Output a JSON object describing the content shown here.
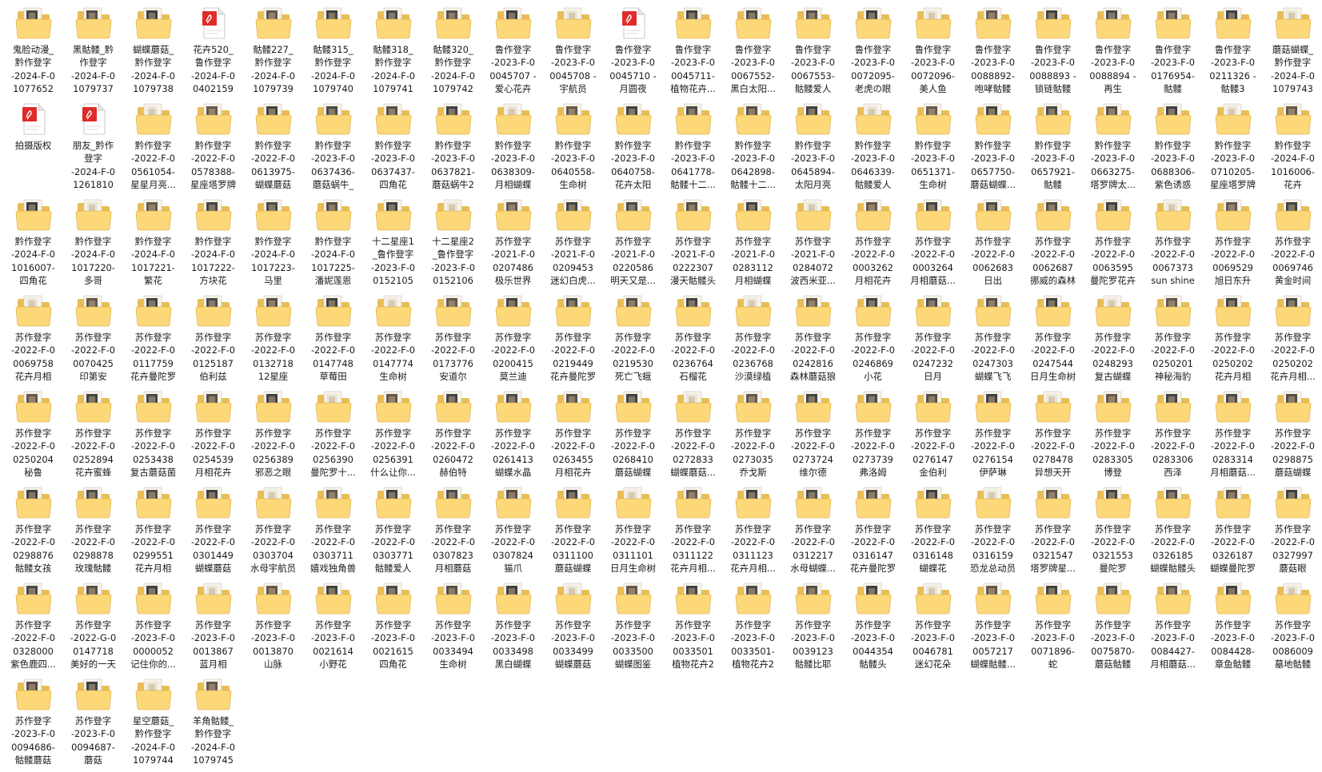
{
  "rows": [
    [
      {
        "icon": "folder-icon",
        "label": "鬼脸动漫_\n黔作登字\n-2024-F-0\n1077652"
      },
      {
        "icon": "folder-icon",
        "label": "黑骷髅_黔\n作登字\n-2024-F-0\n1079737"
      },
      {
        "icon": "folder-icon",
        "label": "蝴蝶蘑菇_\n黔作登字\n-2024-F-0\n1079738"
      },
      {
        "icon": "pdf-file-icon",
        "label": "花卉520_\n鲁作登字\n-2024-F-0\n0402159"
      },
      {
        "icon": "folder-icon",
        "label": "骷髅227_\n黔作登字\n-2024-F-0\n1079739"
      },
      {
        "icon": "folder-icon",
        "label": "骷髅315_\n黔作登字\n-2024-F-0\n1079740"
      },
      {
        "icon": "folder-icon",
        "label": "骷髅318_\n黔作登字\n-2024-F-0\n1079741"
      },
      {
        "icon": "folder-icon",
        "label": "骷髅320_\n黔作登字\n-2024-F-0\n1079742"
      },
      {
        "icon": "folder-icon",
        "label": "鲁作登字\n-2023-F-0\n0045707 -\n爱心花卉"
      },
      {
        "icon": "folder-icon",
        "label": "鲁作登字\n-2023-F-0\n0045708 -\n宇航员"
      },
      {
        "icon": "pdf-file-icon",
        "label": "鲁作登字\n-2023-F-0\n0045710 -\n月圆夜"
      },
      {
        "icon": "folder-icon",
        "label": "鲁作登字\n-2023-F-0\n0045711-\n植物花卉..."
      },
      {
        "icon": "folder-icon",
        "label": "鲁作登字\n-2023-F-0\n0067552-\n黑白太阳..."
      },
      {
        "icon": "folder-icon",
        "label": "鲁作登字\n-2023-F-0\n0067553-\n骷髅爱人"
      },
      {
        "icon": "folder-icon",
        "label": "鲁作登字\n-2023-F-0\n0072095-\n老虎の眼"
      },
      {
        "icon": "folder-icon",
        "label": "鲁作登字\n-2023-F-0\n0072096-\n美人鱼"
      },
      {
        "icon": "folder-icon",
        "label": "鲁作登字\n-2023-F-0\n0088892-\n咆哮骷髅"
      },
      {
        "icon": "folder-icon",
        "label": "鲁作登字\n-2023-F-0\n0088893 -\n锁链骷髅"
      },
      {
        "icon": "folder-icon",
        "label": "鲁作登字\n-2023-F-0\n0088894 -\n再生"
      },
      {
        "icon": "folder-icon",
        "label": "鲁作登字\n-2023-F-0\n0176954-\n骷髅"
      },
      {
        "icon": "folder-icon",
        "label": "鲁作登字\n-2023-F-0\n0211326 -\n骷髅3"
      },
      {
        "icon": "folder-icon",
        "label": "蘑菇蝴蝶_\n黔作登字\n-2024-F-0\n1079743"
      }
    ],
    [
      {
        "icon": "pdf-file-icon",
        "label": "拍摄版权"
      },
      {
        "icon": "pdf-file-icon",
        "label": "朋友_黔作\n登字\n-2024-F-0\n1261810"
      },
      {
        "icon": "folder-icon",
        "label": "黔作登字\n-2022-F-0\n0561054-\n星星月亮..."
      },
      {
        "icon": "folder-icon",
        "label": "黔作登字\n-2022-F-0\n0578388-\n星座塔罗牌"
      },
      {
        "icon": "folder-icon",
        "label": "黔作登字\n-2022-F-0\n0613975-\n蝴蝶蘑菇"
      },
      {
        "icon": "folder-icon",
        "label": "黔作登字\n-2023-F-0\n0637436-\n蘑菇蜗牛_"
      },
      {
        "icon": "folder-icon",
        "label": "黔作登字\n-2023-F-0\n0637437-\n四角花"
      },
      {
        "icon": "folder-icon",
        "label": "黔作登字\n-2023-F-0\n0637821-\n蘑菇蜗牛2"
      },
      {
        "icon": "folder-icon",
        "label": "黔作登字\n-2023-F-0\n0638309-\n月相蝴蝶"
      },
      {
        "icon": "folder-icon",
        "label": "黔作登字\n-2023-F-0\n0640558-\n生命树"
      },
      {
        "icon": "folder-icon",
        "label": "黔作登字\n-2023-F-0\n0640758-\n花卉太阳"
      },
      {
        "icon": "folder-icon",
        "label": "黔作登字\n-2023-F-0\n0641778-\n骷髅十二..."
      },
      {
        "icon": "folder-icon",
        "label": "黔作登字\n-2023-F-0\n0642898-\n骷髅十二..."
      },
      {
        "icon": "folder-icon",
        "label": "黔作登字\n-2023-F-0\n0645894-\n太阳月亮"
      },
      {
        "icon": "folder-icon",
        "label": "黔作登字\n-2023-F-0\n0646339-\n骷髅爱人"
      },
      {
        "icon": "folder-icon",
        "label": "黔作登字\n-2023-F-0\n0651371-\n生命树"
      },
      {
        "icon": "folder-icon",
        "label": "黔作登字\n-2023-F-0\n0657750-\n蘑菇蝴蝶..."
      },
      {
        "icon": "folder-icon",
        "label": "黔作登字\n-2023-F-0\n0657921-\n骷髅"
      },
      {
        "icon": "folder-icon",
        "label": "黔作登字\n-2023-F-0\n0663275-\n塔罗牌太..."
      },
      {
        "icon": "folder-icon",
        "label": "黔作登字\n-2023-F-0\n0688306-\n紫色诱惑"
      },
      {
        "icon": "folder-icon",
        "label": "黔作登字\n-2023-F-0\n0710205-\n星座塔罗牌"
      },
      {
        "icon": "folder-icon",
        "label": "黔作登字\n-2024-F-0\n1016006-\n花卉"
      }
    ],
    [
      {
        "icon": "folder-icon",
        "label": "黔作登字\n-2024-F-0\n1016007-\n四角花"
      },
      {
        "icon": "folder-icon",
        "label": "黔作登字\n-2024-F-0\n1017220-\n多哥"
      },
      {
        "icon": "folder-icon",
        "label": "黔作登字\n-2024-F-0\n1017221-\n繁花"
      },
      {
        "icon": "folder-icon",
        "label": "黔作登字\n-2024-F-0\n1017222-\n方块花"
      },
      {
        "icon": "folder-icon",
        "label": "黔作登字\n-2024-F-0\n1017223-\n马里"
      },
      {
        "icon": "folder-icon",
        "label": "黔作登字\n-2024-F-0\n1017225-\n潘妮莲恩"
      },
      {
        "icon": "folder-icon",
        "label": "十二星座1\n_鲁作登字\n-2023-F-0\n0152105"
      },
      {
        "icon": "folder-icon",
        "label": "十二星座2\n_鲁作登字\n-2023-F-0\n0152106"
      },
      {
        "icon": "folder-icon",
        "label": "苏作登字\n-2021-F-0\n0207486\n极乐世界"
      },
      {
        "icon": "folder-icon",
        "label": "苏作登字\n-2021-F-0\n0209453\n迷幻白虎..."
      },
      {
        "icon": "folder-icon",
        "label": "苏作登字\n-2021-F-0\n0220586\n明天又是..."
      },
      {
        "icon": "folder-icon",
        "label": "苏作登字\n-2021-F-0\n0222307\n漫天骷髅头"
      },
      {
        "icon": "folder-icon",
        "label": "苏作登字\n-2021-F-0\n0283112\n月相蝴蝶"
      },
      {
        "icon": "folder-icon",
        "label": "苏作登字\n-2021-F-0\n0284072\n波西米亚..."
      },
      {
        "icon": "folder-icon",
        "label": "苏作登字\n-2022-F-0\n0003262\n月相花卉"
      },
      {
        "icon": "folder-icon",
        "label": "苏作登字\n-2022-F-0\n0003264\n月相蘑菇..."
      },
      {
        "icon": "folder-icon",
        "label": "苏作登字\n-2022-F-0\n0062683\n日出"
      },
      {
        "icon": "folder-icon",
        "label": "苏作登字\n-2022-F-0\n0062687\n挪威的森林"
      },
      {
        "icon": "folder-icon",
        "label": "苏作登字\n-2022-F-0\n0063595\n曼陀罗花卉"
      },
      {
        "icon": "folder-icon",
        "label": "苏作登字\n-2022-F-0\n0067373\nsun shine"
      },
      {
        "icon": "folder-icon",
        "label": "苏作登字\n-2022-F-0\n0069529\n旭日东升"
      },
      {
        "icon": "folder-icon",
        "label": "苏作登字\n-2022-F-0\n0069746\n黄金时间"
      }
    ],
    [
      {
        "icon": "folder-icon",
        "label": "苏作登字\n-2022-F-0\n0069758\n花卉月相"
      },
      {
        "icon": "folder-icon",
        "label": "苏作登字\n-2022-F-0\n0070425\n印第安"
      },
      {
        "icon": "folder-icon",
        "label": "苏作登字\n-2022-F-0\n0117759\n花卉曼陀罗"
      },
      {
        "icon": "folder-icon",
        "label": "苏作登字\n-2022-F-0\n0125187\n伯利兹"
      },
      {
        "icon": "folder-icon",
        "label": "苏作登字\n-2022-F-0\n0132718\n12星座"
      },
      {
        "icon": "folder-icon",
        "label": "苏作登字\n-2022-F-0\n0147748\n草莓田"
      },
      {
        "icon": "folder-icon",
        "label": "苏作登字\n-2022-F-0\n0147774\n生命树"
      },
      {
        "icon": "folder-icon",
        "label": "苏作登字\n-2022-F-0\n0173776\n安道尔"
      },
      {
        "icon": "folder-icon",
        "label": "苏作登字\n-2022-F-0\n0200415\n莫兰迪"
      },
      {
        "icon": "folder-icon",
        "label": "苏作登字\n-2022-F-0\n0219449\n花卉曼陀罗"
      },
      {
        "icon": "folder-icon",
        "label": "苏作登字\n-2022-F-0\n0219530\n死亡飞蛾"
      },
      {
        "icon": "folder-icon",
        "label": "苏作登字\n-2022-F-0\n0236764\n石榴花"
      },
      {
        "icon": "folder-icon",
        "label": "苏作登字\n-2022-F-0\n0236768\n沙漠绿植"
      },
      {
        "icon": "folder-icon",
        "label": "苏作登字\n-2022-F-0\n0242816\n森林蘑菇狼"
      },
      {
        "icon": "folder-icon",
        "label": "苏作登字\n-2022-F-0\n0246869\n小花"
      },
      {
        "icon": "folder-icon",
        "label": "苏作登字\n-2022-F-0\n0247232\n日月"
      },
      {
        "icon": "folder-icon",
        "label": "苏作登字\n-2022-F-0\n0247303\n蝴蝶飞飞"
      },
      {
        "icon": "folder-icon",
        "label": "苏作登字\n-2022-F-0\n0247544\n日月生命树"
      },
      {
        "icon": "folder-icon",
        "label": "苏作登字\n-2022-F-0\n0248293\n复古蝴蝶"
      },
      {
        "icon": "folder-icon",
        "label": "苏作登字\n-2022-F-0\n0250201\n神秘海豹"
      },
      {
        "icon": "folder-icon",
        "label": "苏作登字\n-2022-F-0\n0250202\n花卉月相"
      },
      {
        "icon": "folder-icon",
        "label": "苏作登字\n-2022-F-0\n0250202\n花卉月相..."
      }
    ],
    [
      {
        "icon": "folder-icon",
        "label": "苏作登字\n-2022-F-0\n0250204\n秘鲁"
      },
      {
        "icon": "folder-icon",
        "label": "苏作登字\n-2022-F-0\n0252894\n花卉蜜蜂"
      },
      {
        "icon": "folder-icon",
        "label": "苏作登字\n-2022-F-0\n0253438\n复古蘑菇菌"
      },
      {
        "icon": "folder-icon",
        "label": "苏作登字\n-2022-F-0\n0254539\n月相花卉"
      },
      {
        "icon": "folder-icon",
        "label": "苏作登字\n-2022-F-0\n0256389\n邪恶之眼"
      },
      {
        "icon": "folder-icon",
        "label": "苏作登字\n-2022-F-0\n0256390\n曼陀罗十..."
      },
      {
        "icon": "folder-icon",
        "label": "苏作登字\n-2022-F-0\n0256391\n什么让你..."
      },
      {
        "icon": "folder-icon",
        "label": "苏作登字\n-2022-F-0\n0260472\n赫伯特"
      },
      {
        "icon": "folder-icon",
        "label": "苏作登字\n-2022-F-0\n0261413\n蝴蝶水晶"
      },
      {
        "icon": "folder-icon",
        "label": "苏作登字\n-2022-F-0\n0263455\n月相花卉"
      },
      {
        "icon": "folder-icon",
        "label": "苏作登字\n-2022-F-0\n0268410\n蘑菇蝴蝶"
      },
      {
        "icon": "folder-icon",
        "label": "苏作登字\n-2022-F-0\n0272833\n蝴蝶蘑菇..."
      },
      {
        "icon": "folder-icon",
        "label": "苏作登字\n-2022-F-0\n0273035\n乔戈斯"
      },
      {
        "icon": "folder-icon",
        "label": "苏作登字\n-2022-F-0\n0273724\n维尔德"
      },
      {
        "icon": "folder-icon",
        "label": "苏作登字\n-2022-F-0\n0273739\n弗洛姆"
      },
      {
        "icon": "folder-icon",
        "label": "苏作登字\n-2022-F-0\n0276147\n金伯利"
      },
      {
        "icon": "folder-icon",
        "label": "苏作登字\n-2022-F-0\n0276154\n伊萨琳"
      },
      {
        "icon": "folder-icon",
        "label": "苏作登字\n-2022-F-0\n0278478\n异想天开"
      },
      {
        "icon": "folder-icon",
        "label": "苏作登字\n-2022-F-0\n0283305\n博登"
      },
      {
        "icon": "folder-icon",
        "label": "苏作登字\n-2022-F-0\n0283306\n西泽"
      },
      {
        "icon": "folder-icon",
        "label": "苏作登字\n-2022-F-0\n0283314\n月相蘑菇..."
      },
      {
        "icon": "folder-icon",
        "label": "苏作登字\n-2022-F-0\n0298875\n蘑菇蝴蝶"
      }
    ],
    [
      {
        "icon": "folder-icon",
        "label": "苏作登字\n-2022-F-0\n0298876\n骷髅女孩"
      },
      {
        "icon": "folder-icon",
        "label": "苏作登字\n-2022-F-0\n0298878\n玫瑰骷髅"
      },
      {
        "icon": "folder-icon",
        "label": "苏作登字\n-2022-F-0\n0299551\n花卉月相"
      },
      {
        "icon": "folder-icon",
        "label": "苏作登字\n-2022-F-0\n0301449\n蝴蝶蘑菇"
      },
      {
        "icon": "folder-icon",
        "label": "苏作登字\n-2022-F-0\n0303704\n水母宇航员"
      },
      {
        "icon": "folder-icon",
        "label": "苏作登字\n-2022-F-0\n0303711\n嬉戏独角兽"
      },
      {
        "icon": "folder-icon",
        "label": "苏作登字\n-2022-F-0\n0303771\n骷髅爱人"
      },
      {
        "icon": "folder-icon",
        "label": "苏作登字\n-2022-F-0\n0307823\n月相蘑菇"
      },
      {
        "icon": "folder-icon",
        "label": "苏作登字\n-2022-F-0\n0307824\n猫爪"
      },
      {
        "icon": "folder-icon",
        "label": "苏作登字\n-2022-F-0\n0311100\n蘑菇蝴蝶"
      },
      {
        "icon": "folder-icon",
        "label": "苏作登字\n-2022-F-0\n0311101\n日月生命树"
      },
      {
        "icon": "folder-icon",
        "label": "苏作登字\n-2022-F-0\n0311122\n花卉月相..."
      },
      {
        "icon": "folder-icon",
        "label": "苏作登字\n-2022-F-0\n0311123\n花卉月相..."
      },
      {
        "icon": "folder-icon",
        "label": "苏作登字\n-2022-F-0\n0312217\n水母蝴蝶..."
      },
      {
        "icon": "folder-icon",
        "label": "苏作登字\n-2022-F-0\n0316147\n花卉曼陀罗"
      },
      {
        "icon": "folder-icon",
        "label": "苏作登字\n-2022-F-0\n0316148\n蝴蝶花"
      },
      {
        "icon": "folder-icon",
        "label": "苏作登字\n-2022-F-0\n0316159\n恐龙总动员"
      },
      {
        "icon": "folder-icon",
        "label": "苏作登字\n-2022-F-0\n0321547\n塔罗牌星..."
      },
      {
        "icon": "folder-icon",
        "label": "苏作登字\n-2022-F-0\n0321553\n曼陀罗"
      },
      {
        "icon": "folder-icon",
        "label": "苏作登字\n-2022-F-0\n0326185\n蝴蝶骷髅头"
      },
      {
        "icon": "folder-icon",
        "label": "苏作登字\n-2022-F-0\n0326187\n蝴蝶曼陀罗"
      },
      {
        "icon": "folder-icon",
        "label": "苏作登字\n-2022-F-0\n0327997\n蘑菇眼"
      }
    ],
    [
      {
        "icon": "folder-icon",
        "label": "苏作登字\n-2022-F-0\n0328000\n紫色鹿四..."
      },
      {
        "icon": "folder-icon",
        "label": "苏作登字\n-2022-G-0\n0147718\n美好的一天"
      },
      {
        "icon": "folder-icon",
        "label": "苏作登字\n-2023-F-0\n0000052\n记住你的..."
      },
      {
        "icon": "folder-icon",
        "label": "苏作登字\n-2023-F-0\n0013867\n蓝月相"
      },
      {
        "icon": "folder-icon",
        "label": "苏作登字\n-2023-F-0\n0013870\n山脉"
      },
      {
        "icon": "folder-icon",
        "label": "苏作登字\n-2023-F-0\n0021614\n小野花"
      },
      {
        "icon": "folder-icon",
        "label": "苏作登字\n-2023-F-0\n0021615\n四角花"
      },
      {
        "icon": "folder-icon",
        "label": "苏作登字\n-2023-F-0\n0033494\n生命树"
      },
      {
        "icon": "folder-icon",
        "label": "苏作登字\n-2023-F-0\n0033498\n黑白蝴蝶"
      },
      {
        "icon": "folder-icon",
        "label": "苏作登字\n-2023-F-0\n0033499\n蝴蝶蘑菇"
      },
      {
        "icon": "folder-icon",
        "label": "苏作登字\n-2023-F-0\n0033500\n蝴蝶图鉴"
      },
      {
        "icon": "folder-icon",
        "label": "苏作登字\n-2023-F-0\n0033501\n植物花卉2"
      },
      {
        "icon": "folder-icon",
        "label": "苏作登字\n-2023-F-0\n0033501-\n植物花卉2"
      },
      {
        "icon": "folder-icon",
        "label": "苏作登字\n-2023-F-0\n0039123\n骷髅比耶"
      },
      {
        "icon": "folder-icon",
        "label": "苏作登字\n-2023-F-0\n0044354\n骷髅头"
      },
      {
        "icon": "folder-icon",
        "label": "苏作登字\n-2023-F-0\n0046781\n迷幻花朵"
      },
      {
        "icon": "folder-icon",
        "label": "苏作登字\n-2023-F-0\n0057217\n蝴蝶骷髅..."
      },
      {
        "icon": "folder-icon",
        "label": "苏作登字\n-2023-F-0\n0071896-\n蛇"
      },
      {
        "icon": "folder-icon",
        "label": "苏作登字\n-2023-F-0\n0075870-\n蘑菇骷髅"
      },
      {
        "icon": "folder-icon",
        "label": "苏作登字\n-2023-F-0\n0084427-\n月相蘑菇..."
      },
      {
        "icon": "folder-icon",
        "label": "苏作登字\n-2023-F-0\n0084428-\n章鱼骷髅"
      },
      {
        "icon": "folder-icon",
        "label": "苏作登字\n-2023-F-0\n0086009\n墓地骷髅"
      }
    ],
    [
      {
        "icon": "folder-icon",
        "label": "苏作登字\n-2023-F-0\n0094686-\n骷髅蘑菇"
      },
      {
        "icon": "folder-icon",
        "label": "苏作登字\n-2023-F-0\n0094687-\n蘑菇"
      },
      {
        "icon": "folder-icon",
        "label": "星空蘑菇_\n黔作登字\n-2024-F-0\n1079744"
      },
      {
        "icon": "folder-icon",
        "label": "羊角骷髅_\n黔作登字\n-2024-F-0\n1079745"
      }
    ]
  ],
  "colors": {
    "folder_back": "#e8bd55",
    "folder_front": "#fcd878",
    "folder_edge": "#d6a53e",
    "paper": "#f7f3ea",
    "pdf_red": "#e02b2b"
  }
}
